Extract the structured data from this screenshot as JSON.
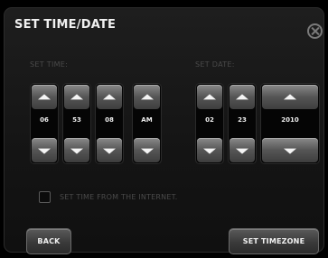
{
  "dialog": {
    "title": "SET TIME/DATE"
  },
  "time": {
    "label": "SET TIME:",
    "hour": "06",
    "minute": "53",
    "second": "08",
    "ampm": "AM"
  },
  "date": {
    "label": "SET DATE:",
    "month": "02",
    "day": "23",
    "year": "2010"
  },
  "internet_sync": {
    "label": "SET TIME FROM THE INTERNET.",
    "checked": false
  },
  "buttons": {
    "back": "BACK",
    "set_timezone": "SET TIMEZONE"
  },
  "icons": {
    "close": "close-icon",
    "up": "chevron-up-icon",
    "down": "chevron-down-icon"
  }
}
